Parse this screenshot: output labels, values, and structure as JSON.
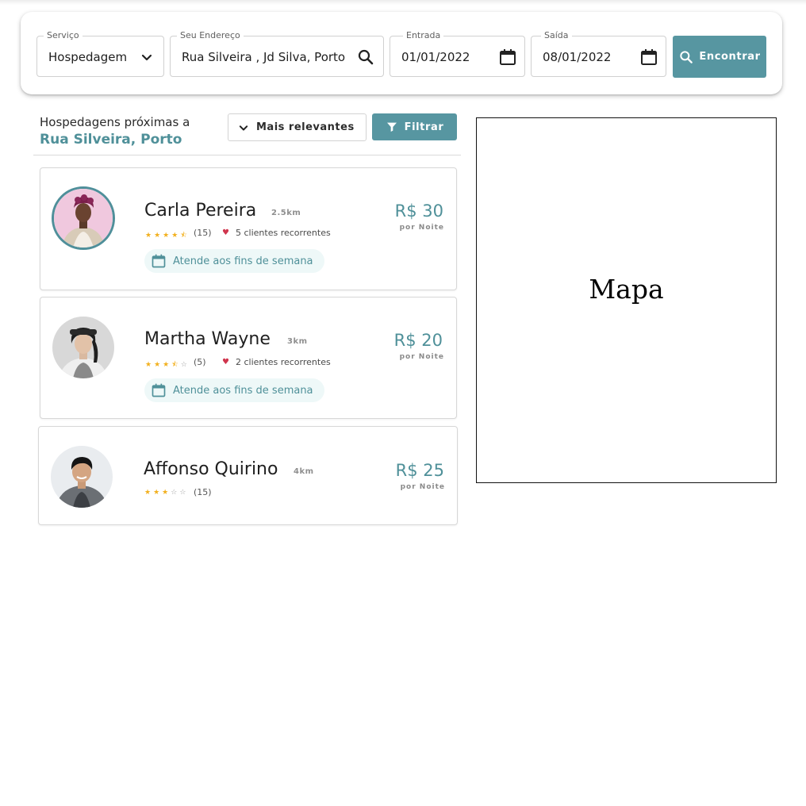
{
  "search": {
    "service": {
      "label": "Serviço",
      "value": "Hospedagem"
    },
    "address": {
      "label": "Seu Endereço",
      "value": "Rua Silveira , Jd Silva, Porto"
    },
    "checkin": {
      "label": "Entrada",
      "value": "01/01/2022"
    },
    "checkout": {
      "label": "Saída",
      "value": "08/01/2022"
    },
    "find_button": "Encontrar"
  },
  "results": {
    "title": "Hospedagens próximas a",
    "location": "Rua Silveira, Porto",
    "sort_value": "Mais relevantes",
    "filter_button": "Filtrar"
  },
  "hosts": [
    {
      "name": "Carla Pereira",
      "distance": "2.5km",
      "rating": 4.5,
      "reviews": "(15)",
      "recurring": "5 clientes recorrentes",
      "badge": "Atende aos fins de semana",
      "price": "R$ 30",
      "per": "por Noite"
    },
    {
      "name": "Martha Wayne",
      "distance": "3km",
      "rating": 3.5,
      "reviews": "(5)",
      "recurring": "2 clientes recorrentes",
      "badge": "Atende aos fins de semana",
      "price": "R$ 20",
      "per": "por Noite"
    },
    {
      "name": "Affonso Quirino",
      "distance": "4km",
      "rating": 3,
      "reviews": "(15)",
      "price": "R$ 25",
      "per": "por Noite"
    }
  ],
  "map": {
    "label": "Mapa"
  },
  "colors": {
    "accent": "#5796a1",
    "accent_text": "#4f9099",
    "star": "#f2b01e",
    "heart": "#d0354d",
    "badge_bg": "#eef8f8"
  },
  "icons": [
    "chevron-down-icon",
    "search-icon",
    "calendar-icon",
    "filter-icon",
    "star-icon",
    "heart-icon"
  ]
}
